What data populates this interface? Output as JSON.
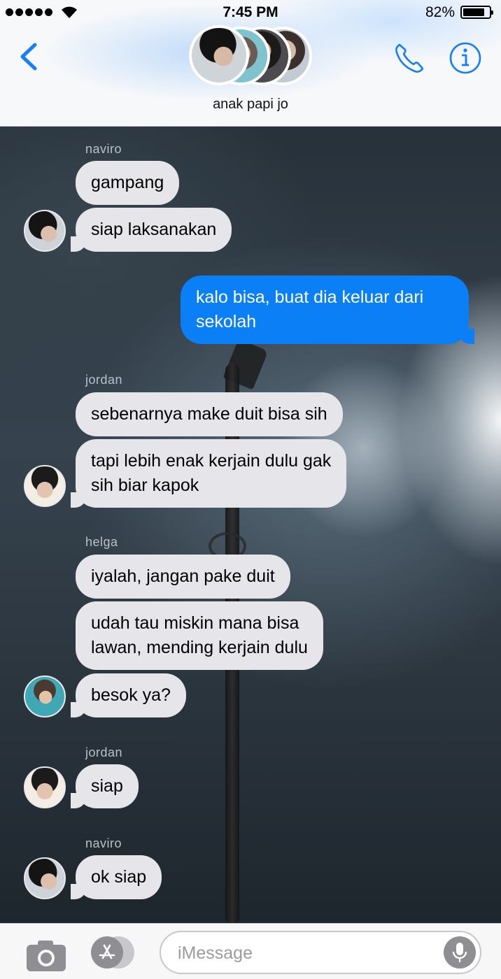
{
  "status_bar": {
    "time": "7:45 PM",
    "battery_percent": "82%",
    "signal_bars": 5,
    "battery_level": 0.82
  },
  "header": {
    "group_name": "anak papi jo",
    "back_icon": "chevron-left-icon",
    "phone_icon": "phone-icon",
    "info_icon": "info-icon",
    "accent_color": "#147efb"
  },
  "messages": [
    {
      "sender": "naviro",
      "text": "gampang",
      "direction": "incoming"
    },
    {
      "sender": "",
      "text": "siap laksanakan",
      "direction": "incoming"
    },
    {
      "sender": "",
      "text": "kalo bisa, buat dia keluar dari sekolah",
      "direction": "outgoing"
    },
    {
      "sender": "jordan",
      "text": "sebenarnya make duit bisa sih",
      "direction": "incoming"
    },
    {
      "sender": "",
      "text": "tapi lebih enak kerjain dulu gak sih biar kapok",
      "direction": "incoming"
    },
    {
      "sender": "helga",
      "text": "iyalah, jangan pake duit",
      "direction": "incoming"
    },
    {
      "sender": "",
      "text": "udah tau miskin mana bisa lawan, mending kerjain dulu",
      "direction": "incoming"
    },
    {
      "sender": "",
      "text": "besok ya?",
      "direction": "incoming"
    },
    {
      "sender": "jordan",
      "text": "siap",
      "direction": "incoming"
    },
    {
      "sender": "naviro",
      "text": "ok siap",
      "direction": "incoming"
    }
  ],
  "message_lines": {
    "m3_line1": "kalo bisa, buat dia keluar dari",
    "m3_line2": "sekolah",
    "m5_line1": "tapi lebih enak kerjain dulu gak",
    "m5_line2": "sih biar kapok",
    "m7_line1": "udah tau miskin mana bisa",
    "m7_line2": "lawan, mending kerjain dulu"
  },
  "input_bar": {
    "placeholder": "iMessage",
    "camera_icon": "camera-icon",
    "apps_icon": "app-store-icon",
    "mic_icon": "microphone-icon"
  },
  "colors": {
    "incoming_bubble": "#e5e5ea",
    "outgoing_bubble": "#0b7ff5"
  }
}
